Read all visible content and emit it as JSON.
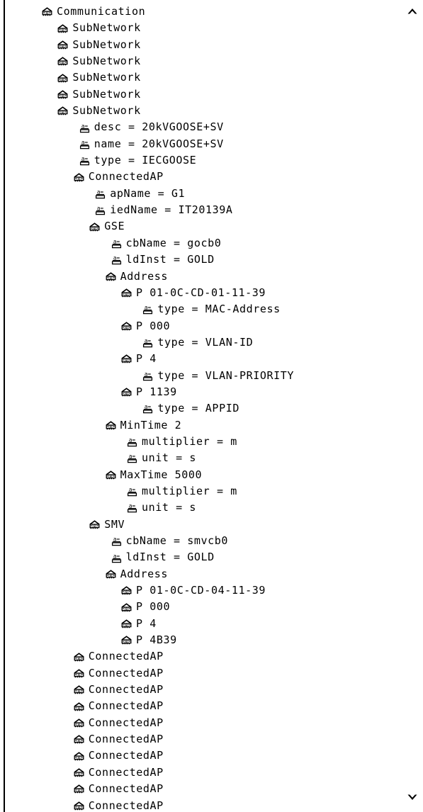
{
  "viewer": {
    "title": "Communication",
    "scroll_up_icon": "chevron-up-icon",
    "scroll_down_icon": "chevron-down-icon",
    "border_color": "#000000",
    "text_color": "#000000",
    "background_color": "#ffffff"
  },
  "icons": {
    "element": "xml-element-icon",
    "attribute": "xml-attribute-icon"
  },
  "rows": [
    {
      "label": "Communication",
      "type": "element",
      "depth": 0
    },
    {
      "label": "SubNetwork",
      "type": "element",
      "depth": 1
    },
    {
      "label": "SubNetwork",
      "type": "element",
      "depth": 1
    },
    {
      "label": "SubNetwork",
      "type": "element",
      "depth": 1
    },
    {
      "label": "SubNetwork",
      "type": "element",
      "depth": 1
    },
    {
      "label": "SubNetwork",
      "type": "element",
      "depth": 1
    },
    {
      "label": "SubNetwork",
      "type": "element",
      "depth": 1
    },
    {
      "label": "desc = 20kVGOOSE+SV",
      "type": "attribute",
      "depth": 2
    },
    {
      "label": "name = 20kVGOOSE+SV",
      "type": "attribute",
      "depth": 2
    },
    {
      "label": "type = IECGOOSE",
      "type": "attribute",
      "depth": 2
    },
    {
      "label": "ConnectedAP",
      "type": "element",
      "depth": 2
    },
    {
      "label": "apName = G1",
      "type": "attribute",
      "depth": 3
    },
    {
      "label": "iedName = IT20139A",
      "type": "attribute",
      "depth": 3
    },
    {
      "label": "GSE",
      "type": "element",
      "depth": 3
    },
    {
      "label": "cbName = gocb0",
      "type": "attribute",
      "depth": 4
    },
    {
      "label": "ldInst = GOLD",
      "type": "attribute",
      "depth": 4
    },
    {
      "label": "Address",
      "type": "element",
      "depth": 4
    },
    {
      "label": "P 01-0C-CD-01-11-39",
      "type": "element",
      "depth": 5
    },
    {
      "label": "type = MAC-Address",
      "type": "attribute",
      "depth": 6
    },
    {
      "label": "P 000",
      "type": "element",
      "depth": 5
    },
    {
      "label": "type = VLAN-ID",
      "type": "attribute",
      "depth": 6
    },
    {
      "label": "P 4",
      "type": "element",
      "depth": 5
    },
    {
      "label": "type = VLAN-PRIORITY",
      "type": "attribute",
      "depth": 6
    },
    {
      "label": "P 1139",
      "type": "element",
      "depth": 5
    },
    {
      "label": "type = APPID",
      "type": "attribute",
      "depth": 6
    },
    {
      "label": "MinTime 2",
      "type": "element",
      "depth": 4
    },
    {
      "label": "multiplier = m",
      "type": "attribute",
      "depth": 5
    },
    {
      "label": "unit = s",
      "type": "attribute",
      "depth": 5
    },
    {
      "label": "MaxTime 5000",
      "type": "element",
      "depth": 4
    },
    {
      "label": "multiplier = m",
      "type": "attribute",
      "depth": 5
    },
    {
      "label": "unit = s",
      "type": "attribute",
      "depth": 5
    },
    {
      "label": "SMV",
      "type": "element",
      "depth": 3
    },
    {
      "label": "cbName = smvcb0",
      "type": "attribute",
      "depth": 4
    },
    {
      "label": "ldInst = GOLD",
      "type": "attribute",
      "depth": 4
    },
    {
      "label": "Address",
      "type": "element",
      "depth": 4
    },
    {
      "label": "P 01-0C-CD-04-11-39",
      "type": "element",
      "depth": 5
    },
    {
      "label": "P 000",
      "type": "element",
      "depth": 5
    },
    {
      "label": "P 4",
      "type": "element",
      "depth": 5
    },
    {
      "label": "P 4B39",
      "type": "element",
      "depth": 5
    },
    {
      "label": "ConnectedAP",
      "type": "element",
      "depth": 2
    },
    {
      "label": "ConnectedAP",
      "type": "element",
      "depth": 2
    },
    {
      "label": "ConnectedAP",
      "type": "element",
      "depth": 2
    },
    {
      "label": "ConnectedAP",
      "type": "element",
      "depth": 2
    },
    {
      "label": "ConnectedAP",
      "type": "element",
      "depth": 2
    },
    {
      "label": "ConnectedAP",
      "type": "element",
      "depth": 2
    },
    {
      "label": "ConnectedAP",
      "type": "element",
      "depth": 2
    },
    {
      "label": "ConnectedAP",
      "type": "element",
      "depth": 2
    },
    {
      "label": "ConnectedAP",
      "type": "element",
      "depth": 2
    },
    {
      "label": "ConnectedAP",
      "type": "element",
      "depth": 2
    }
  ]
}
